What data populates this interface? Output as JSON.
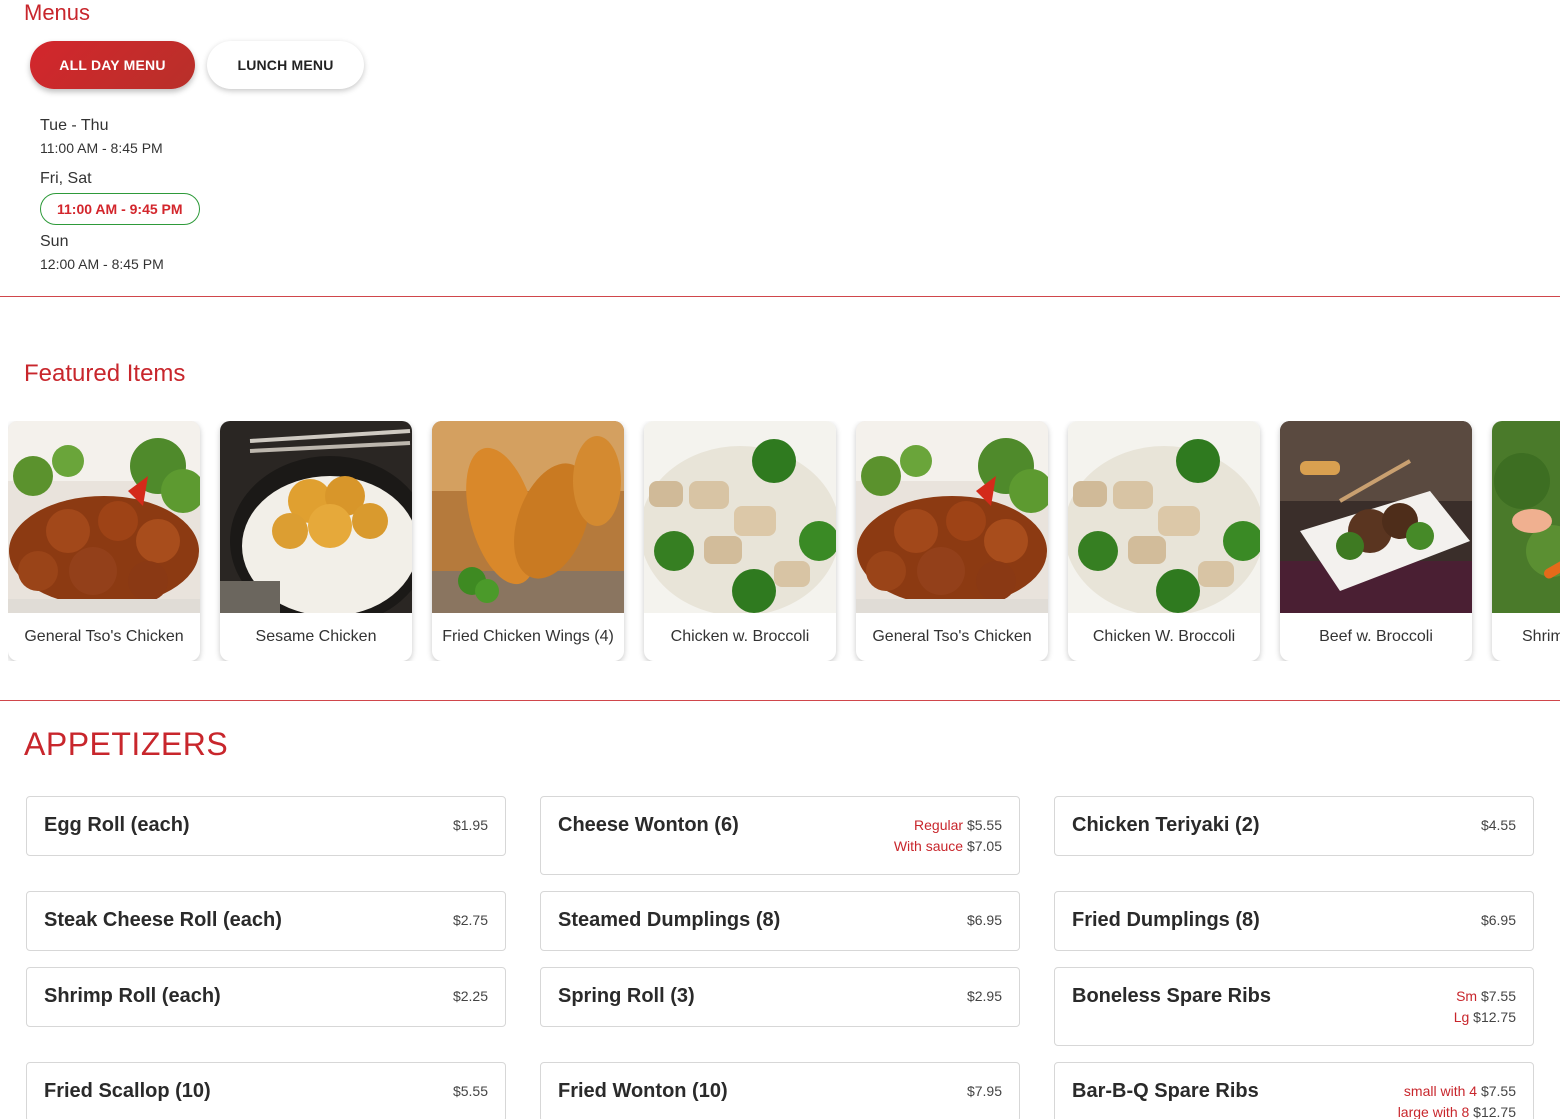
{
  "menus": {
    "title": "Menus",
    "tabs": [
      {
        "label": "ALL DAY MENU",
        "active": true
      },
      {
        "label": "LUNCH MENU",
        "active": false
      }
    ],
    "hours": [
      {
        "days": "Tue - Thu",
        "time": "11:00 AM - 8:45 PM",
        "current": false
      },
      {
        "days": "Fri, Sat",
        "time": "11:00 AM - 9:45 PM",
        "current": true
      },
      {
        "days": "Sun",
        "time": "12:00 AM - 8:45 PM",
        "current": false
      }
    ]
  },
  "featured": {
    "title": "Featured Items",
    "items": [
      {
        "name": "General Tso's Chicken",
        "image": "general-tso-chicken-photo"
      },
      {
        "name": "Sesame Chicken",
        "image": "sesame-chicken-photo"
      },
      {
        "name": "Fried Chicken Wings (4)",
        "image": "fried-chicken-wings-photo"
      },
      {
        "name": "Chicken w. Broccoli",
        "image": "chicken-broccoli-photo"
      },
      {
        "name": "General Tso's Chicken",
        "image": "general-tso-chicken-photo"
      },
      {
        "name": "Chicken W. Broccoli",
        "image": "chicken-broccoli-photo"
      },
      {
        "name": "Beef w. Broccoli",
        "image": "beef-broccoli-photo"
      },
      {
        "name": "Shrim",
        "image": "shrimp-photo"
      }
    ]
  },
  "appetizers": {
    "title": "APPETIZERS",
    "items": [
      {
        "name": "Egg Roll (each)",
        "prices": [
          {
            "label": "",
            "price": "$1.95"
          }
        ]
      },
      {
        "name": "Cheese Wonton (6)",
        "prices": [
          {
            "label": "Regular",
            "price": "$5.55"
          },
          {
            "label": "With sauce",
            "price": "$7.05"
          }
        ]
      },
      {
        "name": "Chicken Teriyaki (2)",
        "prices": [
          {
            "label": "",
            "price": "$4.55"
          }
        ]
      },
      {
        "name": "Steak Cheese Roll (each)",
        "prices": [
          {
            "label": "",
            "price": "$2.75"
          }
        ]
      },
      {
        "name": "Steamed Dumplings (8)",
        "prices": [
          {
            "label": "",
            "price": "$6.95"
          }
        ]
      },
      {
        "name": "Fried Dumplings (8)",
        "prices": [
          {
            "label": "",
            "price": "$6.95"
          }
        ]
      },
      {
        "name": "Shrimp Roll (each)",
        "prices": [
          {
            "label": "",
            "price": "$2.25"
          }
        ]
      },
      {
        "name": "Spring Roll (3)",
        "prices": [
          {
            "label": "",
            "price": "$2.95"
          }
        ]
      },
      {
        "name": "Boneless Spare Ribs",
        "prices": [
          {
            "label": "Sm",
            "price": "$7.55"
          },
          {
            "label": "Lg",
            "price": "$12.75"
          }
        ]
      },
      {
        "name": "Fried Scallop (10)",
        "prices": [
          {
            "label": "",
            "price": "$5.55"
          }
        ]
      },
      {
        "name": "Fried Wonton (10)",
        "prices": [
          {
            "label": "",
            "price": "$7.95"
          }
        ]
      },
      {
        "name": "Bar-B-Q Spare Ribs",
        "prices": [
          {
            "label": "small with 4",
            "price": "$7.55"
          },
          {
            "label": "large with 8",
            "price": "$12.75"
          }
        ]
      }
    ]
  },
  "colors": {
    "accent": "#c8262c",
    "current_hours_border": "#2e9a3a"
  }
}
